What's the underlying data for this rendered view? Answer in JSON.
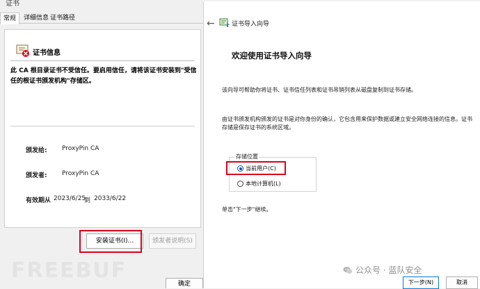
{
  "cert_dialog": {
    "title": "证书",
    "tabs": [
      "常规",
      "详细信息",
      "证书路径"
    ],
    "info_title": "证书信息",
    "warning": "此 CA 根目录证书不受信任。要启用信任，请将该证书安装到\"受信任的根证书颁发机构\"存储区。",
    "issued_to_label": "颁发给:",
    "issued_to_value": "ProxyPin CA",
    "issued_by_label": "颁发者:",
    "issued_by_value": "ProxyPin CA",
    "validity_label": "有效期从",
    "validity_from": "2023/6/25",
    "validity_to_word": "到",
    "validity_to": "2033/6/22",
    "install_button": "安装证书(I)...",
    "issuer_statement_button": "颁发者说明(S)",
    "ok_button": "确定",
    "watermark": "FREEBUF"
  },
  "wizard": {
    "back_icon": "back-arrow-icon",
    "title": "证书导入向导",
    "heading": "欢迎使用证书导入向导",
    "intro": "该向导可帮助你将证书、证书信任列表和证书吊销列表从磁盘复制到证书存储。",
    "description": "由证书颁发机构颁发的证书是对你身份的确认，它包含用来保护数据或建立安全网络连接的信息。证书存储是保存证书的系统区域。",
    "store_location_label": "存储位置",
    "options": [
      {
        "label": "当前用户(C)",
        "selected": true
      },
      {
        "label": "本地计算机(L)",
        "selected": false
      }
    ],
    "continue_text": "单击\"下一步\"继续。",
    "next_button": "下一步(N)",
    "cancel_button": "取消",
    "watermark": "公众号 · 蓝队安全"
  },
  "colors": {
    "highlight": "#d9001b",
    "accent": "#0b5cad"
  }
}
